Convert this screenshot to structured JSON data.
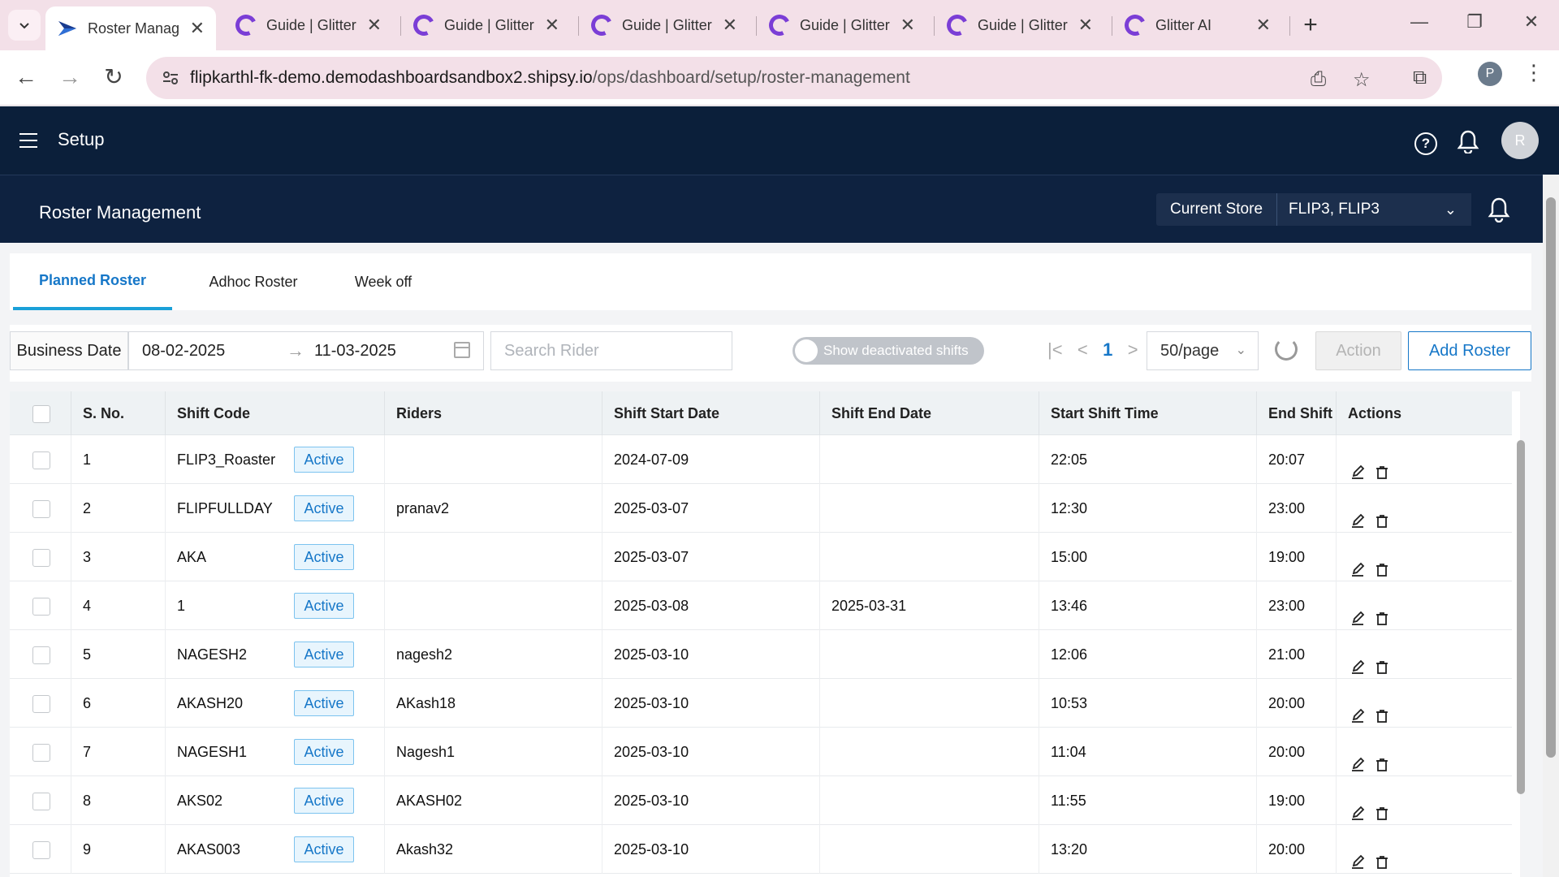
{
  "browser": {
    "tabs": [
      {
        "label": "Roster Manag",
        "active": true
      },
      {
        "label": "Guide | Glitter"
      },
      {
        "label": "Guide | Glitter"
      },
      {
        "label": "Guide | Glitter"
      },
      {
        "label": "Guide | Glitter"
      },
      {
        "label": "Guide | Glitter"
      },
      {
        "label": "Glitter AI"
      }
    ],
    "url_host": "flipkarthl-fk-demo.demodashboardsandbox2.shipsy.io",
    "url_path": "/ops/dashboard/setup/roster-management",
    "profile_initial": "P"
  },
  "app": {
    "title": "Setup",
    "user_initial": "R",
    "help_glyph": "?"
  },
  "page": {
    "title": "Roster Management",
    "store_label": "Current Store",
    "store_value": "FLIP3, FLIP3"
  },
  "roster_tabs": [
    "Planned Roster",
    "Adhoc Roster",
    "Week off"
  ],
  "filters": {
    "business_date_label": "Business Date",
    "start_date": "08-02-2025",
    "end_date": "11-03-2025",
    "search_placeholder": "Search Rider",
    "toggle_label": "Show deactivated shifts",
    "current_page": "1",
    "per_page": "50/page",
    "action_label": "Action",
    "add_label": "Add Roster"
  },
  "table": {
    "headers": [
      "S. No.",
      "Shift Code",
      "Riders",
      "Shift Start Date",
      "Shift End Date",
      "Start Shift Time",
      "End Shift T",
      "Actions"
    ],
    "status_label": "Active",
    "rows": [
      {
        "sno": "1",
        "code": "FLIP3_Roaster",
        "rider": "",
        "start_date": "2024-07-09",
        "end_date": "",
        "start_time": "22:05",
        "end_time": "20:07"
      },
      {
        "sno": "2",
        "code": "FLIPFULLDAY",
        "rider": "pranav2",
        "start_date": "2025-03-07",
        "end_date": "",
        "start_time": "12:30",
        "end_time": "23:00"
      },
      {
        "sno": "3",
        "code": "AKA",
        "rider": "",
        "start_date": "2025-03-07",
        "end_date": "",
        "start_time": "15:00",
        "end_time": "19:00"
      },
      {
        "sno": "4",
        "code": "1",
        "rider": "",
        "start_date": "2025-03-08",
        "end_date": "2025-03-31",
        "start_time": "13:46",
        "end_time": "23:00"
      },
      {
        "sno": "5",
        "code": "NAGESH2",
        "rider": "nagesh2",
        "start_date": "2025-03-10",
        "end_date": "",
        "start_time": "12:06",
        "end_time": "21:00"
      },
      {
        "sno": "6",
        "code": "AKASH20",
        "rider": "AKash18",
        "start_date": "2025-03-10",
        "end_date": "",
        "start_time": "10:53",
        "end_time": "20:00"
      },
      {
        "sno": "7",
        "code": "NAGESH1",
        "rider": "Nagesh1",
        "start_date": "2025-03-10",
        "end_date": "",
        "start_time": "11:04",
        "end_time": "20:00"
      },
      {
        "sno": "8",
        "code": "AKS02",
        "rider": "AKASH02",
        "start_date": "2025-03-10",
        "end_date": "",
        "start_time": "11:55",
        "end_time": "19:00"
      },
      {
        "sno": "9",
        "code": "AKAS003",
        "rider": "Akash32",
        "start_date": "2025-03-10",
        "end_date": "",
        "start_time": "13:20",
        "end_time": "20:00"
      }
    ]
  },
  "colors": {
    "header_bg": "#0b1f3a",
    "accent": "#1677c8",
    "badge_bg": "#e8f5fd"
  }
}
